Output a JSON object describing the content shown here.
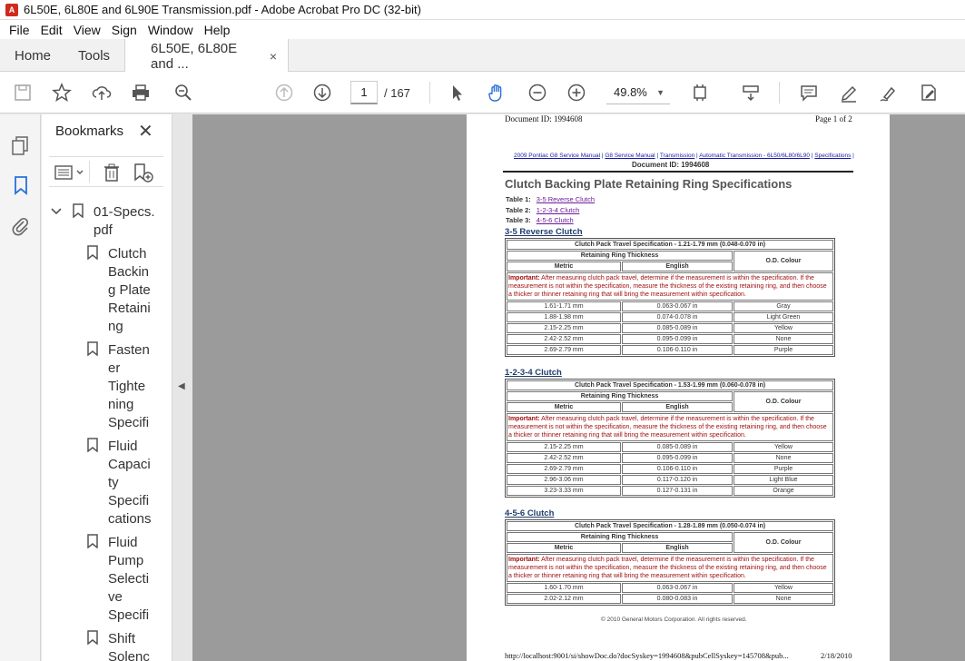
{
  "window": {
    "title": "6L50E, 6L80E and 6L90E Transmission.pdf - Adobe Acrobat Pro DC (32-bit)"
  },
  "menu": [
    "File",
    "Edit",
    "View",
    "Sign",
    "Window",
    "Help"
  ],
  "tabs": {
    "home": "Home",
    "tools": "Tools",
    "doc": "6L50E, 6L80E and ...",
    "close": "×"
  },
  "toolbar": {
    "page_current": "1",
    "page_total": "/  167",
    "zoom": "49.8%"
  },
  "bookmarks": {
    "title": "Bookmarks",
    "close": "✕",
    "items": [
      {
        "label": "01-Specs.\npdf"
      },
      {
        "label": "Clutch\nBackin\ng Plate\nRetaini\nng"
      },
      {
        "label": "Fasten\ner\nTighte\nning\nSpecifi"
      },
      {
        "label": "Fluid\nCapaci\nty\nSpecifi\ncations"
      },
      {
        "label": "Fluid\nPump\nSelecti\nve\nSpecifi"
      },
      {
        "label": "Shift\nSolenc"
      }
    ]
  },
  "document": {
    "header_left": "Document ID: 1994608",
    "header_right": "Page 1 of 2",
    "breadcrumb": [
      "2009 Pontiac G8 Service Manual",
      "G8 Service Manual",
      "Transmission",
      "Automatic Transmission - 6L50/6L80/6L90",
      "Specifications"
    ],
    "docid_center": "Document ID: 1994608",
    "title": "Clutch Backing Plate Retaining Ring Specifications",
    "table_refs": [
      {
        "label": "Table 1:",
        "link": "3-5 Reverse Clutch"
      },
      {
        "label": "Table 2:",
        "link": "1-2-3-4 Clutch"
      },
      {
        "label": "Table 3:",
        "link": "4-5-6 Clutch"
      }
    ],
    "col_retaining": "Retaining Ring Thickness",
    "col_od": "O.D. Colour",
    "col_metric": "Metric",
    "col_english": "English",
    "important_label": "Important:",
    "important_text": "After measuring clutch pack travel, determine if the measurement is within the specification. If the measurement is not within the specification, measure the thickness of the existing retaining ring, and then choose a thicker or thinner retaining ring that will bring the measurement within specification.",
    "sections": [
      {
        "heading": "3-5 Reverse Clutch",
        "travel": "Clutch Pack Travel Specification - 1.21-1.79 mm (0.048-0.070 in)",
        "rows": [
          [
            "1.61-1.71 mm",
            "0.063-0.067 in",
            "Gray"
          ],
          [
            "1.88-1.98 mm",
            "0.074-0.078 in",
            "Light Green"
          ],
          [
            "2.15-2.25 mm",
            "0.085-0.089 in",
            "Yellow"
          ],
          [
            "2.42-2.52 mm",
            "0.095-0.099 in",
            "None"
          ],
          [
            "2.69-2.79 mm",
            "0.106-0.110 in",
            "Purple"
          ]
        ]
      },
      {
        "heading": "1-2-3-4 Clutch",
        "travel": "Clutch Pack Travel Specification - 1.53-1.99 mm (0.060-0.078 in)",
        "rows": [
          [
            "2.15-2.25 mm",
            "0.085-0.089 in",
            "Yellow"
          ],
          [
            "2.42-2.52 mm",
            "0.095-0.099 in",
            "None"
          ],
          [
            "2.69-2.79 mm",
            "0.106-0.110 in",
            "Purple"
          ],
          [
            "2.96-3.06 mm",
            "0.117-0.120 in",
            "Light Blue"
          ],
          [
            "3.23-3.33 mm",
            "0.127-0.131 in",
            "Orange"
          ]
        ]
      },
      {
        "heading": "4-5-6 Clutch",
        "travel": "Clutch Pack Travel Specification - 1.28-1.89 mm (0.050-0.074 in)",
        "rows": [
          [
            "1.60-1.70 mm",
            "0.063-0.067 in",
            "Yellow"
          ],
          [
            "2.02-2.12 mm",
            "0.080-0.083 in",
            "None"
          ]
        ]
      }
    ],
    "copyright": "© 2010 General Motors Corporation.  All rights reserved.",
    "footer_url": "http://localhost:9001/si/showDoc.do?docSyskey=1994608&pubCellSyskey=145708&pub...",
    "footer_date": "2/18/2010"
  },
  "colors": {
    "accent": "#2a6fdb",
    "pdf_red": "#d0291d",
    "important": "#a01010",
    "heading": "#1f3e6b"
  }
}
